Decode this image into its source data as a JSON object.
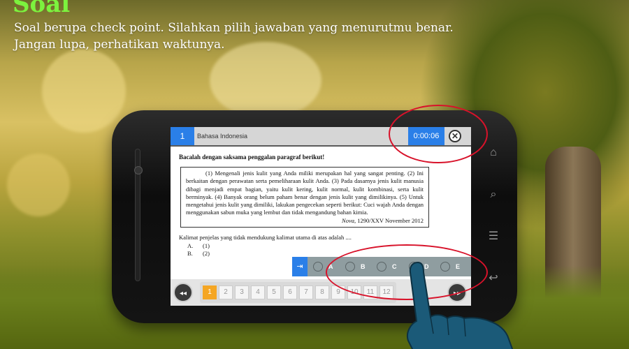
{
  "header": {
    "title": "Soal",
    "instructions": [
      "Soal berupa check point. Silahkan pilih jawaban yang menurutmu benar.",
      "Jangan lupa, perhatikan waktunya."
    ]
  },
  "exam": {
    "question_number": "1",
    "subject": "Bahasa Indonesia",
    "timer": "0:00:06",
    "close_icon": "close-icon",
    "lead": "Bacalah dengan saksama penggalan paragraf berikut!",
    "passage": "(1) Mengenali jenis kulit yang Anda miliki merupakan hal yang sangat penting. (2) Ini berkaitan dengan perawatan serta pemeliharaan kulit Anda. (3) Pada dasarnya jenis kulit manusia dibagi menjadi empat bagian, yaitu kulit kering, kulit normal, kulit kombinasi, serta kulit berminyak. (4) Banyak orang belum paham benar dengan jenis kulit yang dimilikinya. (5) Untuk mengetahui jenis kulit yang dimiliki, lakukan pengecekan seperti berikut: Cuci wajah Anda dengan menggunakan sabun muka yang lembut dan tidak mengandung bahan kimia.",
    "citation_source": "Nova,",
    "citation_rest": " 1290/XXV November 2012",
    "question": "Kalimat penjelas yang tidak mendukung kalimat utama di atas adalah ....",
    "options": [
      {
        "letter": "A.",
        "text": "(1)"
      },
      {
        "letter": "B.",
        "text": "(2)"
      }
    ],
    "answer_choices": [
      "A",
      "B",
      "C",
      "D",
      "E"
    ],
    "pages": [
      "1",
      "2",
      "3",
      "4",
      "5",
      "6",
      "7",
      "8",
      "9",
      "10",
      "11",
      "12"
    ],
    "active_page": "1",
    "prev_label": "◂◂",
    "next_label": "▸▸",
    "answer_toggle": "⇥"
  },
  "colors": {
    "accent_blue": "#2a7fe8",
    "highlight_red": "#d8122a",
    "active_page_orange": "#f5a623",
    "title_green": "#7cf23e",
    "hand_blue": "#1b5a78"
  }
}
